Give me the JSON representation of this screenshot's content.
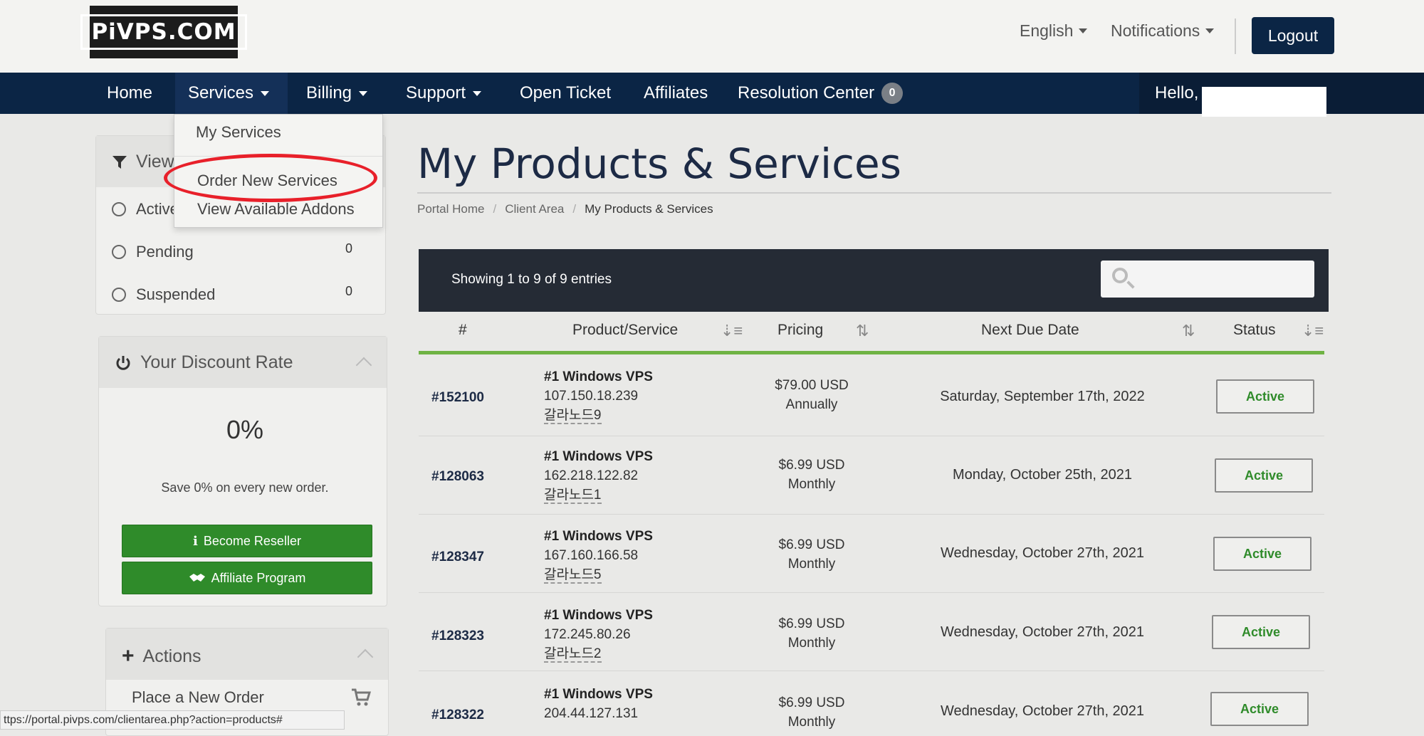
{
  "header": {
    "logo_text": "PiVPS.COM",
    "language": "English",
    "notifications": "Notifications",
    "logout": "Logout"
  },
  "nav": {
    "home": "Home",
    "services": "Services",
    "billing": "Billing",
    "support": "Support",
    "open_ticket": "Open Ticket",
    "affiliates": "Affiliates",
    "resolution_center": "Resolution Center",
    "resolution_count": "0",
    "hello": "Hello,"
  },
  "services_menu": {
    "items": [
      "My Services",
      "Order New Services",
      "View Available Addons"
    ]
  },
  "sidebar": {
    "view_title": "View",
    "filters": [
      {
        "label": "Active",
        "count": ""
      },
      {
        "label": "Pending",
        "count": "0"
      },
      {
        "label": "Suspended",
        "count": "0"
      }
    ],
    "discount_title": "Your Discount Rate",
    "discount_value": "0%",
    "discount_note": "Save 0% on every new order.",
    "reseller_button": "Become Reseller",
    "affiliate_button": "Affiliate Program",
    "actions_title": "Actions",
    "place_order": "Place a New Order"
  },
  "main": {
    "title": "My Products & Services",
    "breadcrumb": [
      "Portal Home",
      "Client Area",
      "My Products & Services"
    ],
    "showing": "Showing 1 to 9 of 9 entries",
    "columns": [
      "#",
      "Product/Service",
      "Pricing",
      "Next Due Date",
      "Status"
    ],
    "rows": [
      {
        "id": "#152100",
        "product": "#1 Windows VPS",
        "ip": "107.150.18.239",
        "domain": "갈라노드9",
        "price": "$79.00 USD",
        "cycle": "Annually",
        "due": "Saturday, September 17th, 2022",
        "status": "Active"
      },
      {
        "id": "#128063",
        "product": "#1 Windows VPS",
        "ip": "162.218.122.82",
        "domain": "갈라노드1",
        "price": "$6.99 USD",
        "cycle": "Monthly",
        "due": "Monday, October 25th, 2021",
        "status": "Active"
      },
      {
        "id": "#128347",
        "product": "#1 Windows VPS",
        "ip": "167.160.166.58",
        "domain": "갈라노드5",
        "price": "$6.99 USD",
        "cycle": "Monthly",
        "due": "Wednesday, October 27th, 2021",
        "status": "Active"
      },
      {
        "id": "#128323",
        "product": "#1 Windows VPS",
        "ip": "172.245.80.26",
        "domain": "갈라노드2",
        "price": "$6.99 USD",
        "cycle": "Monthly",
        "due": "Wednesday, October 27th, 2021",
        "status": "Active"
      },
      {
        "id": "#128322",
        "product": "#1 Windows VPS",
        "ip": "204.44.127.131",
        "domain": "",
        "price": "$6.99 USD",
        "cycle": "Monthly",
        "due": "Wednesday, October 27th, 2021",
        "status": "Active"
      }
    ]
  },
  "statusbar_url": "ttps://portal.pivps.com/clientarea.php?action=products#",
  "colors": {
    "navbar": "#0b2545",
    "accent_green": "#2f8b2a",
    "table_header_bar": "#252b35",
    "highlight_red": "#e8202a"
  }
}
